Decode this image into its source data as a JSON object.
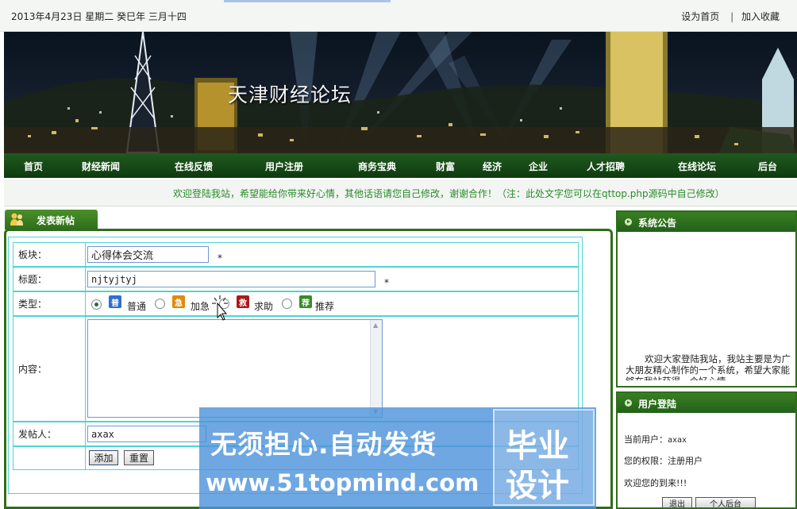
{
  "top_bar": {
    "date": "2013年4月23日  星期二  癸巳年  三月十四",
    "set_home": "设为首页",
    "separator": "|",
    "favorite": "加入收藏"
  },
  "banner": {
    "title": "天津财经论坛"
  },
  "nav": {
    "items": [
      "首页",
      "财经新闻",
      "在线反馈",
      "用户注册",
      "商务宝典",
      "财富",
      "经济",
      "企业",
      "人才招聘",
      "在线论坛",
      "后台"
    ]
  },
  "welcome": "欢迎登陆我站，希望能给你带来好心情，其他话语请您自己修改，谢谢合作！（注：此处文字您可以在qttop.php源码中自己修改）",
  "post_panel": {
    "tab_title": "发表新帖",
    "board_label": "板块：",
    "board_value": "心得体会交流",
    "title_label": "标题：",
    "title_value": "njtyjtyj",
    "required_mark": "*",
    "type_label": "类型：",
    "types": [
      {
        "icon_char": "普",
        "label": "普通",
        "color": "#2f6fd0",
        "selected": true
      },
      {
        "icon_char": "急",
        "label": "加急",
        "color": "#e08a10",
        "selected": false
      },
      {
        "icon_char": "救",
        "label": "求助",
        "color": "#b01818",
        "selected": false
      },
      {
        "icon_char": "荐",
        "label": "推荐",
        "color": "#3a8a2a",
        "selected": false
      }
    ],
    "content_label": "内容：",
    "content_value": "",
    "poster_label": "发帖人：",
    "poster_value": "axax",
    "add_button": "添加",
    "reset_button": "重置"
  },
  "sidebar": {
    "notice": {
      "title": "系统公告",
      "text": "欢迎大家登陆我站，我站主要是为广大朋友精心制作的一个系统，希望大家能够在我站获得一个好心情"
    },
    "login": {
      "title": "用户登陆",
      "current_user_label": "当前用户：",
      "current_user": "axax",
      "role_label": "您的权限：",
      "role": "注册用户",
      "greeting": "欢迎您的到来!!!",
      "logout_button": "退出",
      "admin_button": "个人后台"
    }
  },
  "watermark": {
    "line1": "无须担心.自动发货",
    "line2": "www.51topmind.com",
    "box_line1": "毕业",
    "box_line2": "设计"
  }
}
